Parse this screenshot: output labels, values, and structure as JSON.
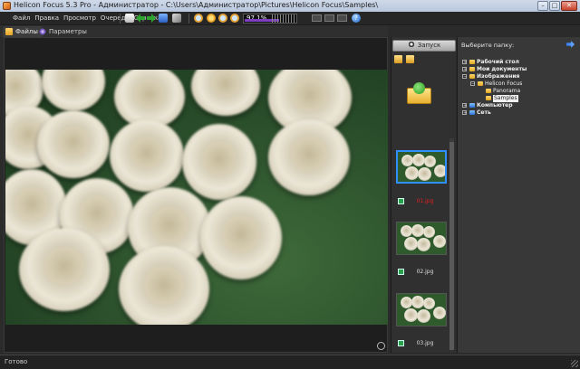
{
  "window": {
    "title": "Helicon Focus 5.3 Pro - Администратор - C:\\Users\\Администратор\\Pictures\\Helicon Focus\\Samples\\",
    "controls": [
      "minimize",
      "maximize",
      "close"
    ]
  },
  "menu": {
    "items": [
      "Файл",
      "Правка",
      "Просмотр",
      "Очередь",
      "Справка"
    ]
  },
  "toolbar": {
    "zoom_value": "97.1%",
    "icons": [
      "save-icon",
      "back-arrow-icon",
      "forward-arrow-icon",
      "export-icon",
      "crop-icon",
      "zoom-in-icon",
      "pan-icon",
      "zoom-out-icon",
      "fit-icon",
      "help-icon"
    ],
    "accent_color": "#7c3cc4"
  },
  "tabs": [
    {
      "label": "Файлы",
      "active": true,
      "icon": "folder-icon"
    },
    {
      "label": "Параметры",
      "active": false,
      "icon": "gear-icon"
    }
  ],
  "thumbs": {
    "run_button": "Запуск",
    "items": [
      {
        "label": "01.jpg",
        "selected": true,
        "highlight_color": "#e02020"
      },
      {
        "label": "02.jpg",
        "selected": false
      },
      {
        "label": "03.jpg",
        "selected": false
      }
    ]
  },
  "tree": {
    "header": "Выберите папку:",
    "items": [
      {
        "label": "Рабочий стол",
        "bold": true,
        "level": 0,
        "expander": "+",
        "icon": "folder"
      },
      {
        "label": "Мои документы",
        "bold": true,
        "level": 0,
        "expander": "+",
        "icon": "folder"
      },
      {
        "label": "Изображения",
        "bold": true,
        "level": 0,
        "expander": "−",
        "icon": "folder"
      },
      {
        "label": "Helicon Focus",
        "bold": false,
        "level": 1,
        "expander": "−",
        "icon": "folder"
      },
      {
        "label": "Panorama",
        "bold": false,
        "level": 2,
        "expander": "",
        "icon": "folder"
      },
      {
        "label": "Samples",
        "bold": false,
        "level": 2,
        "expander": "",
        "icon": "folder",
        "selected": true
      },
      {
        "label": "Компьютер",
        "bold": true,
        "level": 0,
        "expander": "+",
        "icon": "computer"
      },
      {
        "label": "Сеть",
        "bold": true,
        "level": 0,
        "expander": "+",
        "icon": "network"
      }
    ]
  },
  "status": {
    "text": "Готово"
  }
}
